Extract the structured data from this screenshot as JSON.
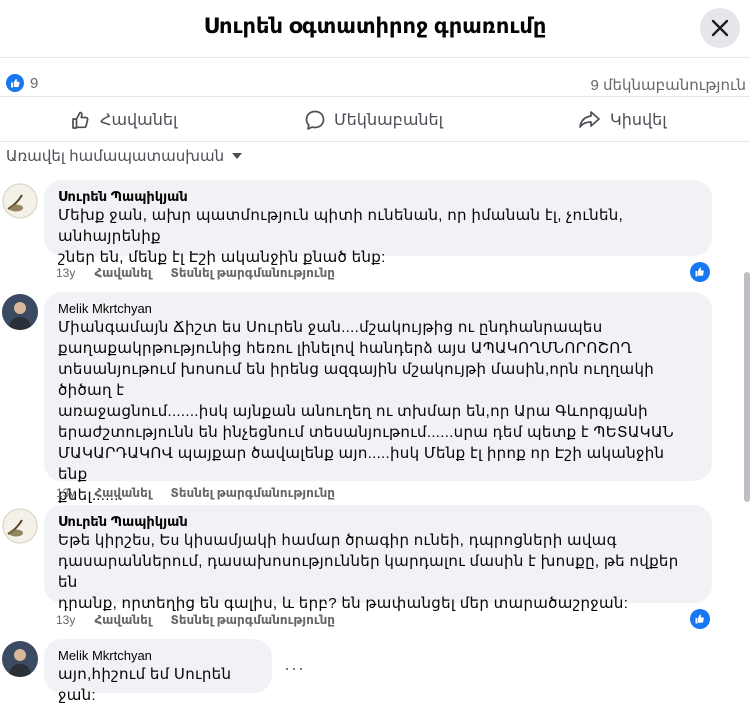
{
  "header": {
    "title": "Սուրեն օգտատիրոջ գրառումը"
  },
  "stats": {
    "likes": "9",
    "comments": "9 մեկնաբանություն"
  },
  "actions": {
    "like": "Հավանել",
    "comment": "Մեկնաբանել",
    "share": "Կիսվել"
  },
  "sort": {
    "label": "Առավել համապատասխան"
  },
  "comments": [
    {
      "author": "Սուրեն Պապիկյան",
      "lines": [
        "Մեխք ջան, ախր պատմություն պիտի ունենան, որ իմանան էլ, չունեն, անհայրենիք",
        "շներ են, մենք էլ Էշի ականջին քնած ենք:"
      ],
      "time": "13у",
      "like": "Հավանել",
      "translate": "Տեսնել թարգմանությունը"
    },
    {
      "author": "Melik Mkrtchyan",
      "lines": [
        "Միանգամայն Ճիշտ ես Սուրեն ջան....մշակույթից ու ընդհանրապես",
        "քաղաքակրթությունից հեռու լինելով հանդերձ այս ԱՊԱԿՈՂՄՆՈՐՈՇՈՂ",
        "տեսանյութում խոսում են իրենց ազգային մշակույթի մասին,որն ուղղակի ծիծաղ է",
        "առաջացնում.......իսկ այնքան անուղեղ ու տխմար են,որ Արա Գևորգյանի",
        "երաժշտությունն են ինչեցնում տեսանյութում......սրա դեմ պետք է ՊԵՏԱԿԱՆ",
        "ՄԱԿԱՐԴԱԿՈՎ պայքար ծավալենք այո.....իսկ Մենք էլ իրոք որ Էշի ականջին ենք",
        "քնել......."
      ],
      "time": "13у",
      "like": "Հավանել",
      "translate": "Տեսնել թարգմանությունը"
    },
    {
      "author": "Սուրեն Պապիկյան",
      "lines": [
        "Եթե կիրշեu, Եu կիսամյակի համար ծրագիր ունեի, դպրոցների ավագ",
        "դասարաններում, դասախոսություններ կարդալու մասին է խոսքը, թե ովքեր են",
        "դրանք, որտեղից են գալիս, և երբ? են թափանցել մեր տարածաշրջան:"
      ],
      "time": "13у",
      "like": "Հավանել",
      "translate": "Տեսնել թարգմանությունը"
    },
    {
      "author": "Melik Mkrtchyan",
      "lines": [
        "այո,հիշում եմ Սուրեն ջան:"
      ]
    }
  ],
  "icons": {
    "close": "close-icon",
    "like_reaction": "like-reaction-icon",
    "thumb": "thumbs-up-icon",
    "comment": "comment-icon",
    "share": "share-icon",
    "dropdown": "caret-down-icon",
    "more": "more-icon"
  },
  "colors": {
    "accent": "#1877f2",
    "bubble": "#f0f2f5",
    "muted": "#65676b"
  }
}
